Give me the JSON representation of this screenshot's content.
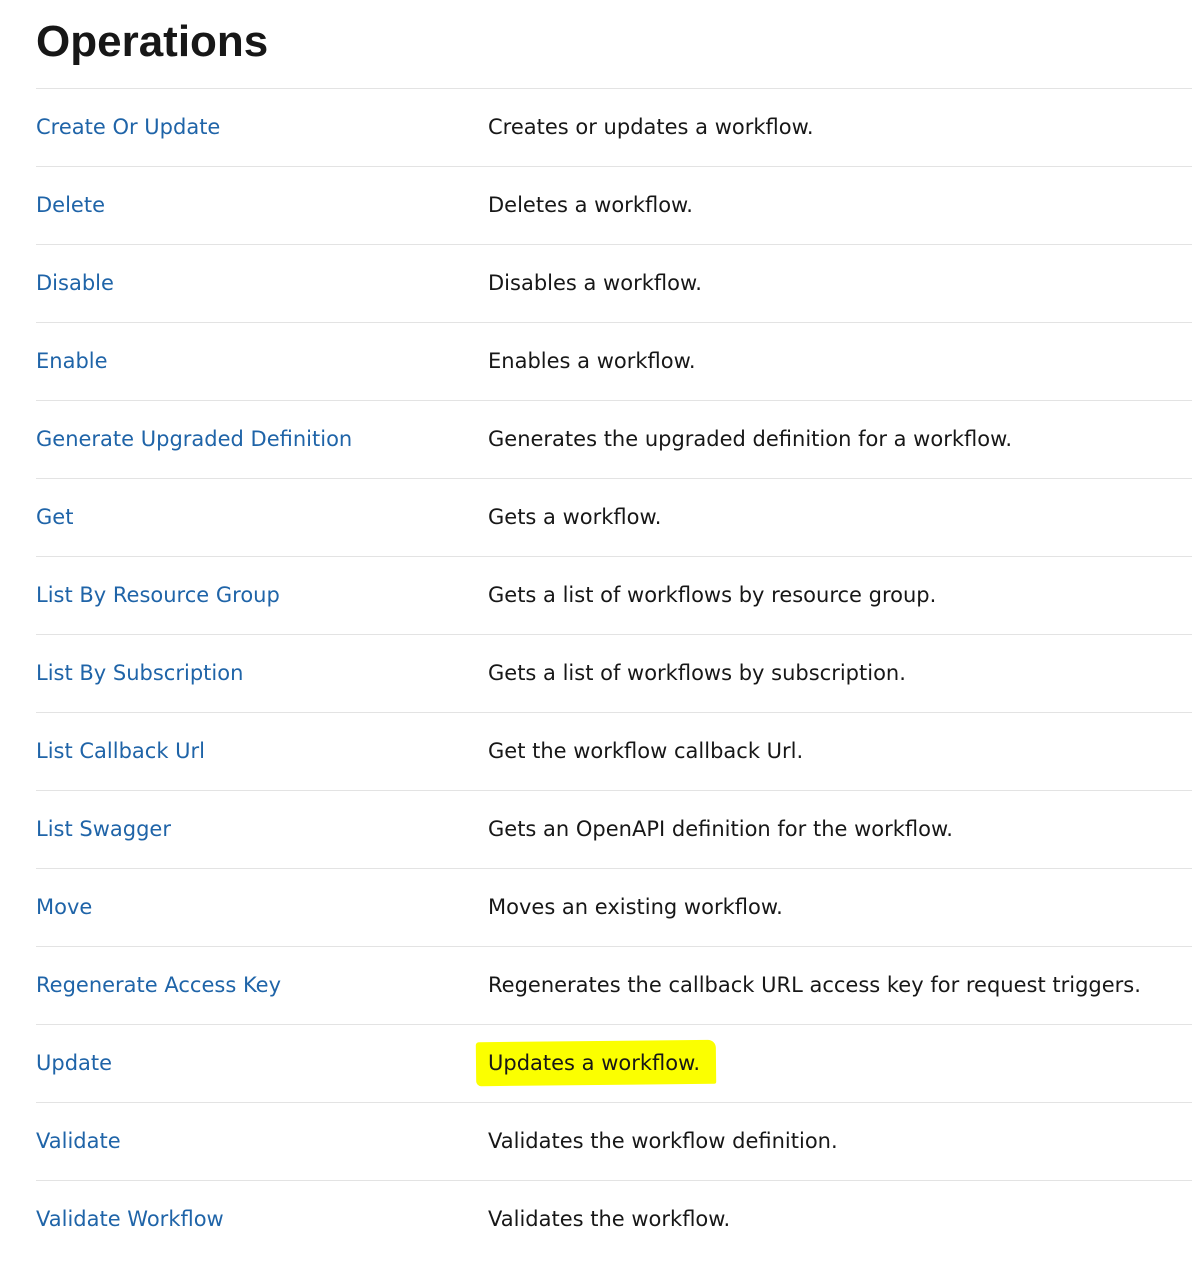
{
  "page": {
    "title": "Operations"
  },
  "highlight_color": "#fbff00",
  "link_color": "#1f64a8",
  "operations": [
    {
      "name": "Create Or Update",
      "description": "Creates or updates a workflow."
    },
    {
      "name": "Delete",
      "description": "Deletes a workflow."
    },
    {
      "name": "Disable",
      "description": "Disables a workflow."
    },
    {
      "name": "Enable",
      "description": "Enables a workflow."
    },
    {
      "name": "Generate Upgraded Definition",
      "description": "Generates the upgraded definition for a workflow."
    },
    {
      "name": "Get",
      "description": "Gets a workflow."
    },
    {
      "name": "List By Resource Group",
      "description": "Gets a list of workflows by resource group."
    },
    {
      "name": "List By Subscription",
      "description": "Gets a list of workflows by subscription."
    },
    {
      "name": "List Callback Url",
      "description": "Get the workflow callback Url."
    },
    {
      "name": "List Swagger",
      "description": "Gets an OpenAPI definition for the workflow."
    },
    {
      "name": "Move",
      "description": "Moves an existing workflow."
    },
    {
      "name": "Regenerate Access Key",
      "description": "Regenerates the callback URL access key for request triggers."
    },
    {
      "name": "Update",
      "description": "Updates a workflow."
    },
    {
      "name": "Validate",
      "description": "Validates the workflow definition."
    },
    {
      "name": "Validate Workflow",
      "description": "Validates the workflow."
    }
  ]
}
